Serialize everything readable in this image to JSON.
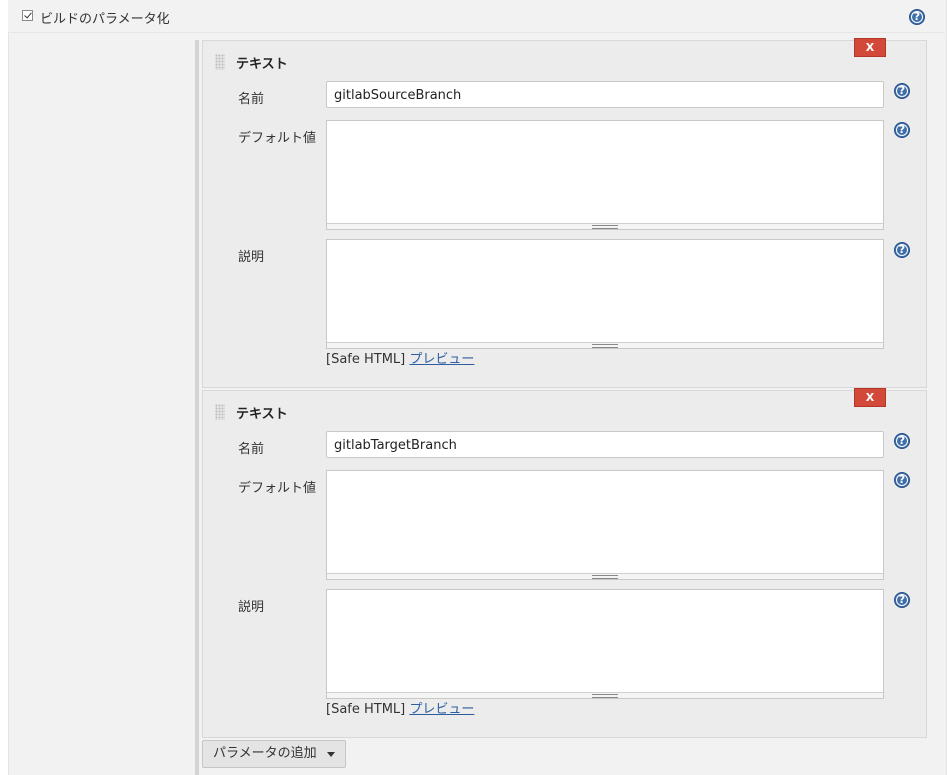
{
  "section": {
    "checkbox_label": "ビルドのパラメータ化",
    "checked": true
  },
  "parameters": [
    {
      "type_label": "テキスト",
      "remove_label": "X",
      "name_label": "名前",
      "name_value": "gitlabSourceBranch",
      "default_label": "デフォルト値",
      "default_value": "",
      "description_label": "説明",
      "description_value": "",
      "safe_html_label": "[Safe HTML]",
      "preview_label": "プレビュー"
    },
    {
      "type_label": "テキスト",
      "remove_label": "X",
      "name_label": "名前",
      "name_value": "gitlabTargetBranch",
      "default_label": "デフォルト値",
      "default_value": "",
      "description_label": "説明",
      "description_value": "",
      "safe_html_label": "[Safe HTML]",
      "preview_label": "プレビュー"
    }
  ],
  "add_parameter_label": "パラメータの追加",
  "help_glyph": "?",
  "colors": {
    "remove_button": "#d24939",
    "help_icon": "#3f6faa",
    "link": "#2c5ea0"
  }
}
